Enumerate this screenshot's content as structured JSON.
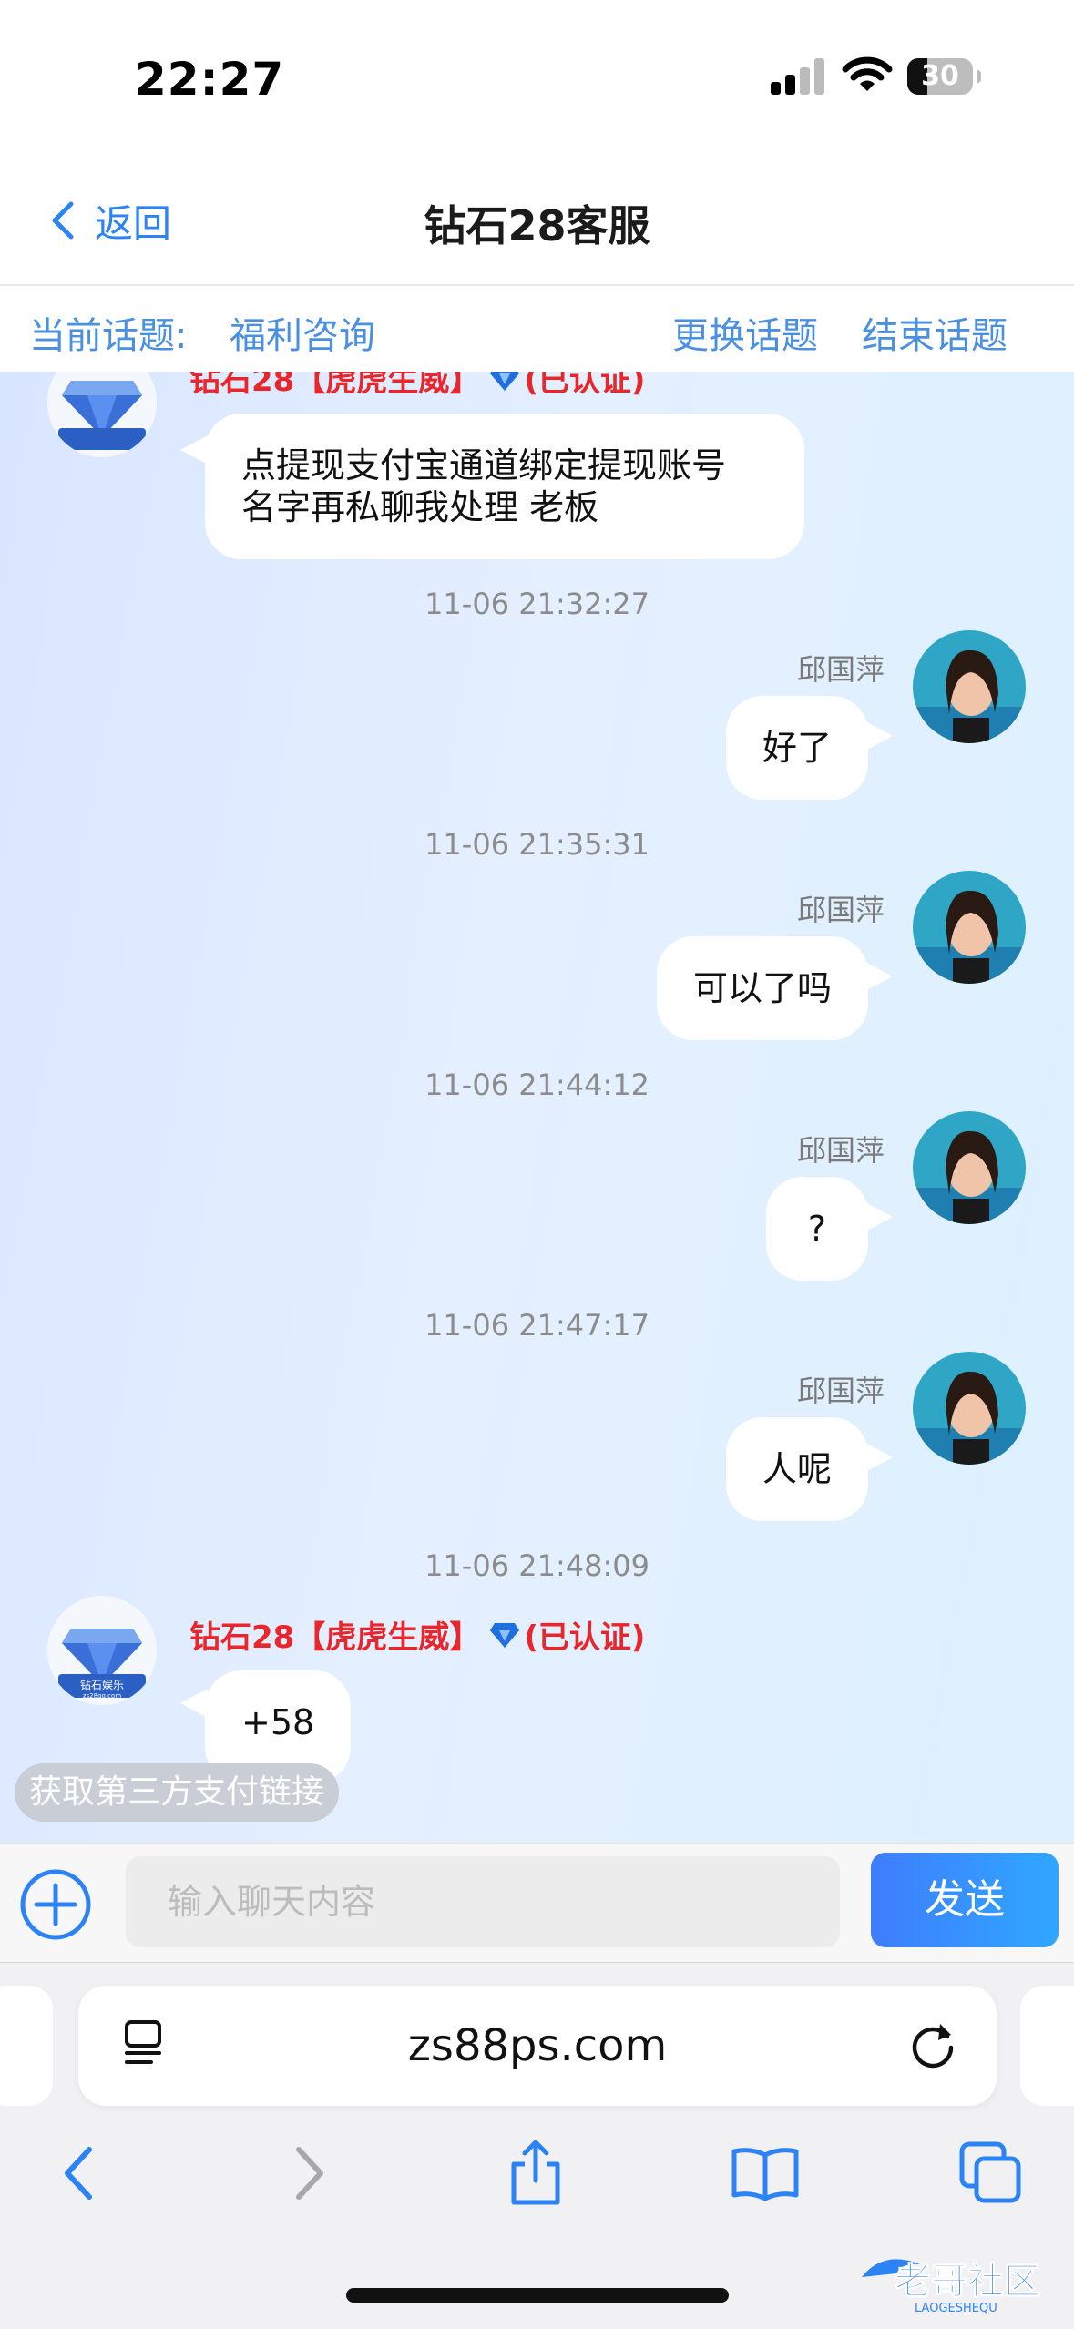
{
  "status_bar": {
    "time": "22:27",
    "battery": "30",
    "battery_level": 0.3
  },
  "nav": {
    "back_label": "返回",
    "title": "钻石28客服"
  },
  "topic": {
    "current_label": "当前话题:",
    "current_value": "福利咨询",
    "change_label": "更换话题",
    "end_label": "结束话题"
  },
  "service_name": "钻石28【虎虎生威】",
  "verified": "(已认证)",
  "service_logo_text": "钻石娱乐",
  "service_logo_sub": "zs28gg.com",
  "messages": [
    {
      "text": "点提现支付宝通道绑定提现账号  名字再私聊我处理 老板"
    },
    {
      "time": "11-06 21:32:27",
      "sender": "邱国萍",
      "text": "好了"
    },
    {
      "time": "11-06 21:35:31",
      "sender": "邱国萍",
      "text": "可以了吗"
    },
    {
      "time": "11-06 21:44:12",
      "sender": "邱国萍",
      "text": "?"
    },
    {
      "time": "11-06 21:47:17",
      "sender": "邱国萍",
      "text": "人呢"
    },
    {
      "time": "11-06 21:48:09",
      "text": "+58"
    }
  ],
  "quick_action": "获取第三方支付链接",
  "composer": {
    "placeholder": "输入聊天内容",
    "send_label": "发送"
  },
  "browser": {
    "url": "zs88ps.com"
  },
  "watermark_text": "老哥社区",
  "watermark_sub": "LAOGESHEQU"
}
